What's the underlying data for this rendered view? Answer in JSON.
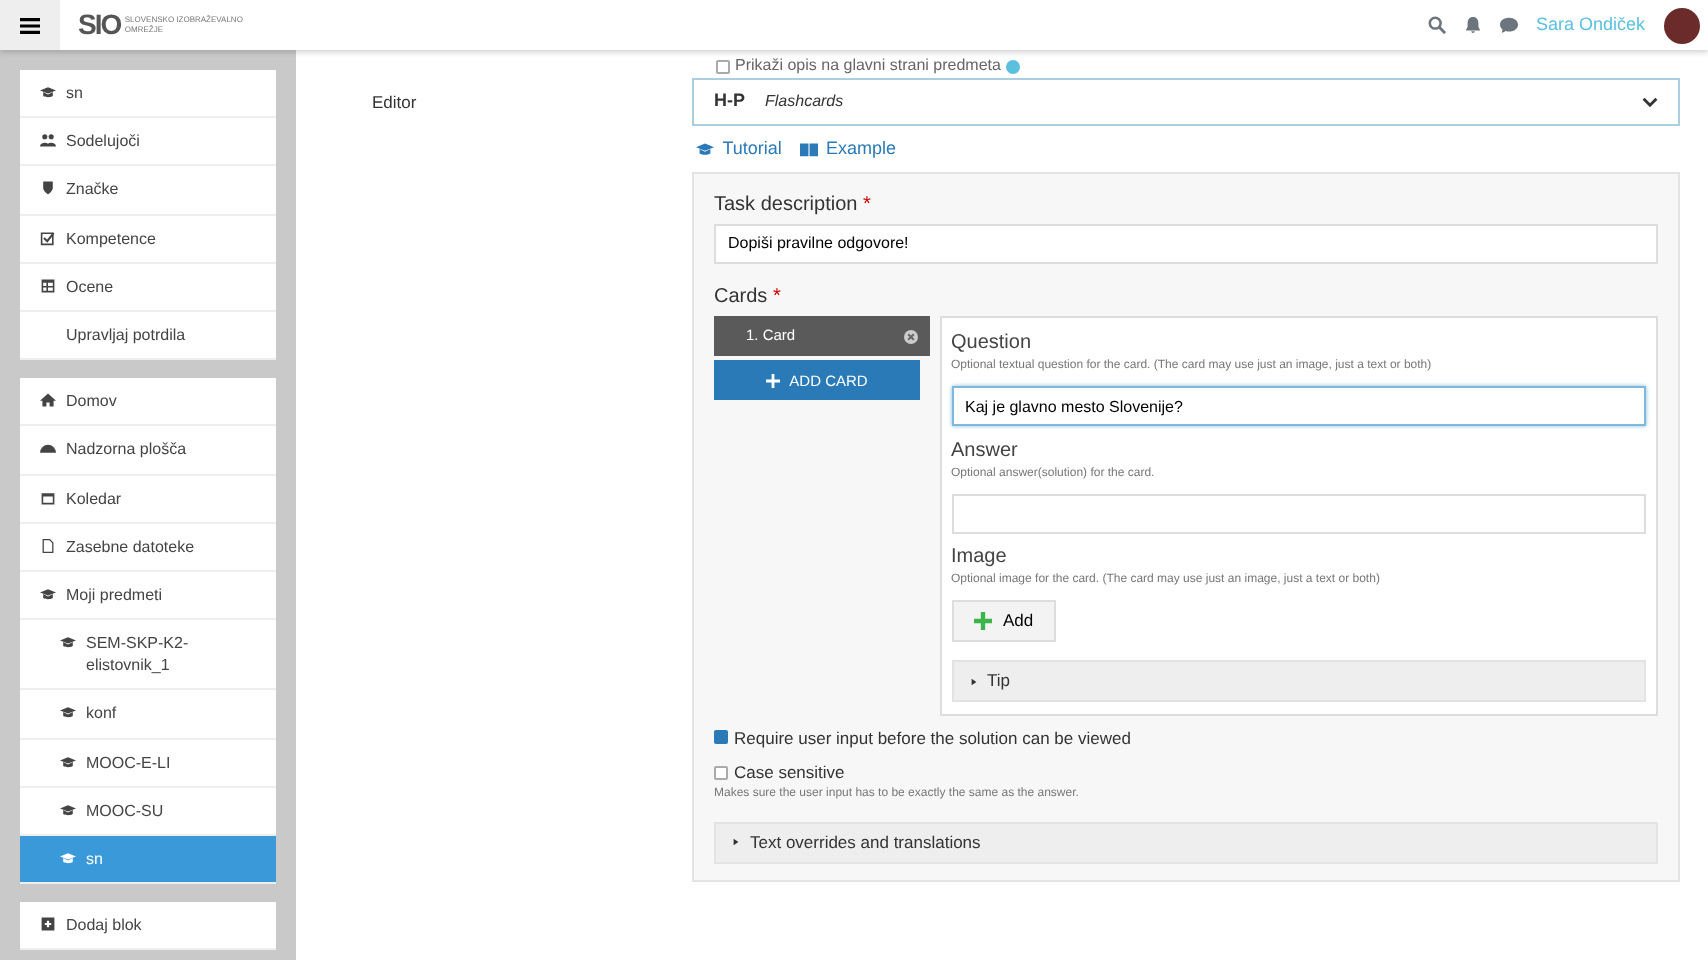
{
  "header": {
    "logo": "SIO",
    "logo_subtitle": "SLOVENSKO IZOBRAŽEVALNO OMREŽJE",
    "user_name": "Sara Ondiček"
  },
  "top_option": {
    "label": "Prikaži opis na glavni strani predmeta",
    "checked": false
  },
  "sidebar": {
    "blocks": [
      {
        "items": [
          {
            "label": "sn",
            "kind": "course",
            "selected": false
          },
          {
            "label": "Sodelujoči",
            "kind": "users",
            "selected": false
          },
          {
            "label": "Značke",
            "kind": "shield",
            "selected": false
          },
          {
            "label": "Kompetence",
            "kind": "check",
            "selected": false
          },
          {
            "label": "Ocene",
            "kind": "table",
            "selected": false
          },
          {
            "label": "Upravljaj potrdila",
            "kind": "none",
            "selected": false
          }
        ]
      },
      {
        "items": [
          {
            "label": "Domov",
            "kind": "home",
            "selected": false
          },
          {
            "label": "Nadzorna plošča",
            "kind": "gauge",
            "selected": false
          },
          {
            "label": "Koledar",
            "kind": "calendar",
            "selected": false
          },
          {
            "label": "Zasebne datoteke",
            "kind": "file",
            "selected": false
          },
          {
            "label": "Moji predmeti",
            "kind": "course",
            "selected": false,
            "children": [
              {
                "label": "SEM-SKP-K2-elistovnik_1",
                "kind": "course",
                "selected": false
              },
              {
                "label": "konf",
                "kind": "course",
                "selected": false
              },
              {
                "label": "MOOC-E-LI",
                "kind": "course",
                "selected": false
              },
              {
                "label": "MOOC-SU",
                "kind": "course",
                "selected": false
              },
              {
                "label": "sn",
                "kind": "course",
                "selected": true
              }
            ]
          }
        ]
      },
      {
        "items": [
          {
            "label": "Dodaj blok",
            "kind": "plus",
            "selected": false
          }
        ]
      }
    ]
  },
  "editor": {
    "label": "Editor",
    "library_logo": "H-P",
    "library": "Flashcards",
    "links": [
      {
        "label": "Tutorial",
        "kind": "course"
      },
      {
        "label": "Example",
        "kind": "book"
      }
    ],
    "task_description": {
      "label": "Task description",
      "required_mark": "*",
      "value": "Dopiši pravilne odgovore!"
    },
    "cards": {
      "label": "Cards",
      "required_mark": "*",
      "items": [
        {
          "label": "1. Card",
          "selected": true
        }
      ],
      "add_button": "ADD CARD",
      "fields": [
        {
          "kind": "text",
          "label": "Question",
          "description": "Optional textual question for the card. (The card may use just an image, just a text or both)",
          "value": "Kaj je glavno mesto Slovenije?",
          "focused": true
        },
        {
          "kind": "text",
          "label": "Answer",
          "description": "Optional answer(solution) for the card.",
          "focused": false
        },
        {
          "kind": "image",
          "label": "Image",
          "description": "Optional image for the card. (The card may use just an image, just a text or both)",
          "button": "Add"
        },
        {
          "kind": "group",
          "label": "Tip"
        }
      ]
    },
    "options": [
      {
        "label": "Require user input before the solution can be viewed",
        "checked": true
      },
      {
        "label": "Case sensitive",
        "checked": false,
        "description": "Makes sure the user input has to be exactly the same as the answer."
      }
    ],
    "overrides": "Text overrides and translations"
  }
}
